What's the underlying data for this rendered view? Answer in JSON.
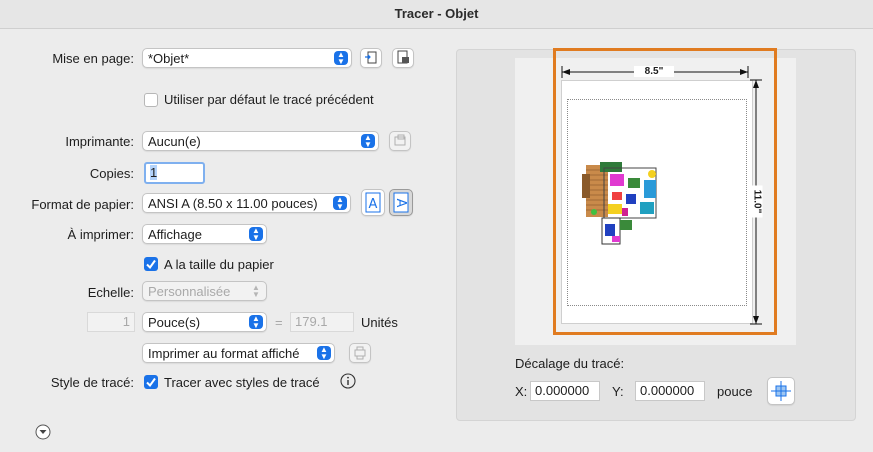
{
  "window": {
    "title": "Tracer - Objet"
  },
  "page_setup": {
    "label": "Mise en page:",
    "value": "*Objet*",
    "use_previous_label": "Utiliser par défaut le tracé précédent",
    "use_previous_checked": false
  },
  "printer": {
    "label": "Imprimante:",
    "value": "Aucun(e)"
  },
  "copies": {
    "label": "Copies:",
    "value": "1"
  },
  "paper_size": {
    "label": "Format de papier:",
    "value": "ANSI A (8.50 x 11.00 pouces)",
    "portrait_glyph": "A",
    "landscape_glyph": "A"
  },
  "what_to_plot": {
    "label": "À imprimer:",
    "value": "Affichage",
    "fit_label": "A la taille du papier",
    "fit_checked": true
  },
  "scale": {
    "label": "Echelle:",
    "value": "Personnalisée",
    "left_value": "1",
    "unit": "Pouce(s)",
    "equals": "=",
    "right_value": "179.1",
    "units_label": "Unités",
    "plot_format": "Imprimer au format affiché"
  },
  "plot_style": {
    "label": "Style de tracé:",
    "checkbox_label": "Tracer avec styles de tracé",
    "checked": true
  },
  "preview": {
    "width_label": "8.5\"",
    "height_label": "11.0\"",
    "accent_color": "#e07b20"
  },
  "offset": {
    "title": "Décalage du tracé:",
    "x_label": "X:",
    "x_value": "0.000000",
    "y_label": "Y:",
    "y_value": "0.000000",
    "unit": "pouce"
  }
}
